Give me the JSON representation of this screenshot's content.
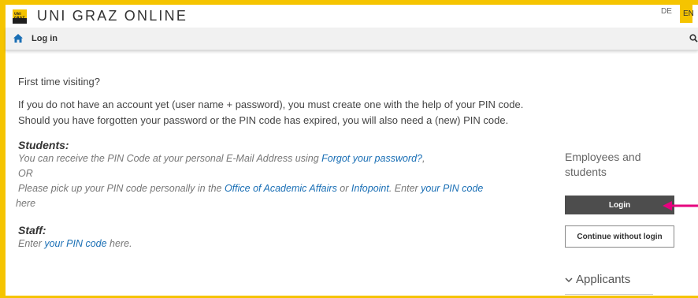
{
  "header": {
    "logo_text": "UNI GRAZ",
    "title": "UNI GRAZ ONLINE",
    "lang_de": "DE",
    "lang_en": "EN"
  },
  "nav": {
    "home_icon": "home-icon",
    "login_label": "Log in",
    "search_icon": "search-icon"
  },
  "main": {
    "intro_heading": "First time visiting?",
    "intro_text": "If you do not have an account yet (user name + password), you must create one with the help of your PIN code. Should you have forgotten your password or the PIN code has expired, you will also need a (new) PIN code.",
    "students": {
      "title": "Students:",
      "line1_prefix": "You can receive the PIN Code at your personal E-Mail Address using ",
      "forgot_link": "Forgot your password?",
      "line1_suffix": ",",
      "or": "OR",
      "line2_prefix": "Please pick up your PIN code personally in the ",
      "office_link": "Office of Academic Affairs",
      "or_word": " or ",
      "infopoint_link": "Infopoint",
      "line2_mid": ". Enter ",
      "pin_link": "your PIN code",
      "line2_suffix": " here"
    },
    "staff": {
      "title": "Staff:",
      "prefix": "Enter ",
      "pin_link": "your PIN code",
      "suffix": " here."
    }
  },
  "sidebar": {
    "heading": "Employees and students",
    "login_button": "Login",
    "continue_button": "Continue without login",
    "applicants": "Applicants"
  },
  "colors": {
    "brand_yellow": "#f5c400",
    "link_blue": "#1a6fb5",
    "button_dark": "#4d4d4d",
    "annotation_arrow": "#e6007e"
  }
}
